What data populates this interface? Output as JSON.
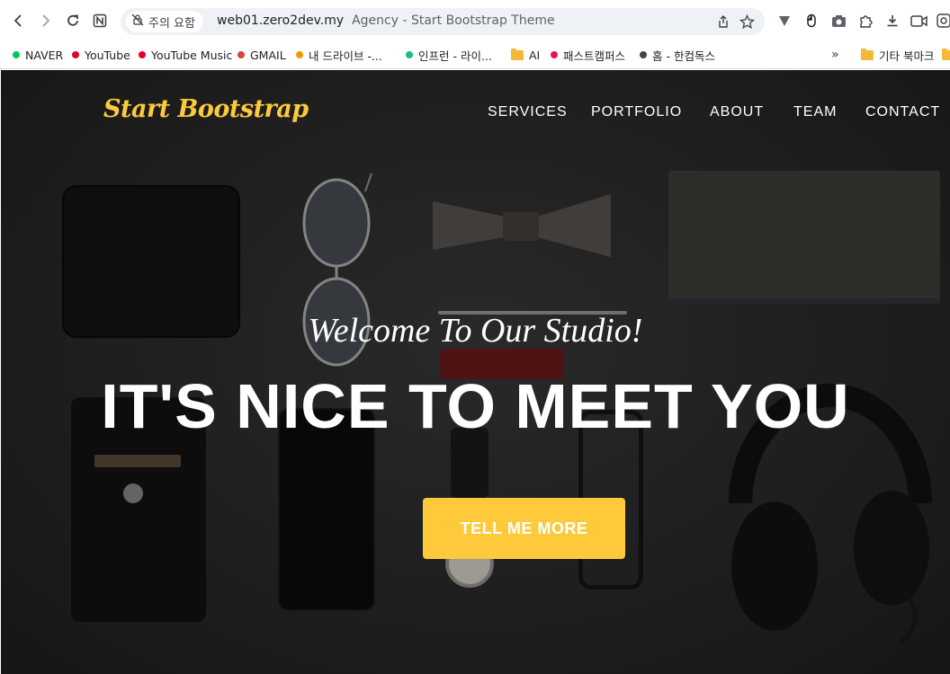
{
  "browser": {
    "security_label": "주의 요함",
    "url_domain": "web01.zero2dev.my",
    "page_title": "Agency - Start Bootstrap Theme",
    "icons": [
      "back-icon",
      "forward-icon",
      "reload-icon",
      "notion-icon",
      "not-secure-icon",
      "share-icon",
      "bookmark-star-icon",
      "extension-v-icon",
      "mouse-icon",
      "camera-icon",
      "puzzle-icon",
      "download-icon",
      "video-icon",
      "extension-icon"
    ]
  },
  "bookmarks": {
    "items": [
      {
        "label": "NAVER",
        "color": "#03c75a"
      },
      {
        "label": "YouTube",
        "color": "#e4002b"
      },
      {
        "label": "YouTube Music",
        "color": "#e4002b"
      },
      {
        "label": "GMAIL",
        "color": "#d44638"
      },
      {
        "label": "내 드라이브 -...",
        "color": "#f29900"
      },
      {
        "label": "인프런 - 라이...",
        "color": "#1dc078"
      },
      {
        "label": "AI",
        "color": "#f5b93a"
      },
      {
        "label": "패스트캠퍼스",
        "color": "#e3135a"
      },
      {
        "label": "홈 - 한컴독스",
        "color": "#444444"
      }
    ],
    "overflow": "»",
    "other_bookmarks": "기타 북마크"
  },
  "site": {
    "brand": "Start Bootstrap",
    "nav": [
      "SERVICES",
      "PORTFOLIO",
      "ABOUT",
      "TEAM",
      "CONTACT"
    ],
    "subheading": "Welcome To Our Studio!",
    "heading": "IT'S NICE TO MEET YOU",
    "cta": "TELL ME MORE",
    "accent_color": "#ffc93c"
  }
}
